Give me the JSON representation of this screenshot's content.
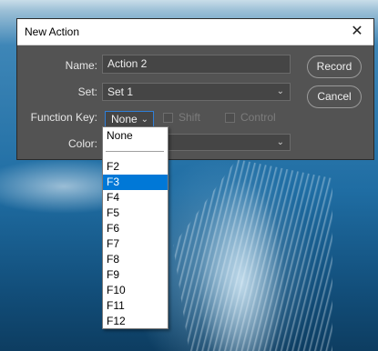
{
  "dialog": {
    "title": "New Action",
    "close_icon": "close-icon"
  },
  "form": {
    "name_label": "Name:",
    "name_value": "Action 2",
    "set_label": "Set:",
    "set_value": "Set 1",
    "function_key_label": "Function Key:",
    "function_key_value": "None",
    "shift_label": "Shift",
    "control_label": "Control",
    "color_label": "Color:"
  },
  "buttons": {
    "record_label": "Record",
    "cancel_label": "Cancel"
  },
  "dropdown": {
    "options": [
      "None",
      "F2",
      "F3",
      "F4",
      "F5",
      "F6",
      "F7",
      "F8",
      "F9",
      "F10",
      "F11",
      "F12"
    ],
    "selected": "F3"
  },
  "colors": {
    "dialog_bg": "#535353",
    "selection": "#0078d7",
    "focus_border": "#2f7fd8"
  }
}
